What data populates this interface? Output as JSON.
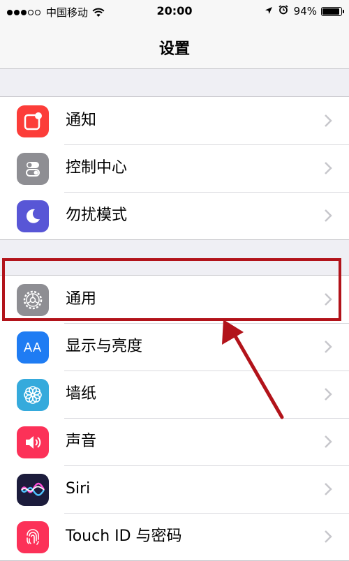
{
  "status_bar": {
    "carrier": "中国移动",
    "time": "20:00",
    "battery_text": "94%",
    "battery_level": 0.94
  },
  "nav": {
    "title": "设置"
  },
  "groups": [
    {
      "items": [
        {
          "label": "通知",
          "icon": "notifications-icon",
          "color": "#fc3d39"
        },
        {
          "label": "控制中心",
          "icon": "control-center-icon",
          "color": "#8e8e93"
        },
        {
          "label": "勿扰模式",
          "icon": "moon-icon",
          "color": "#5856d6"
        }
      ]
    },
    {
      "items": [
        {
          "label": "通用",
          "icon": "gear-icon",
          "color": "#8e8e93"
        },
        {
          "label": "显示与亮度",
          "icon": "display-icon",
          "color": "#1f7cf3",
          "icon_text": "AA"
        },
        {
          "label": "墙纸",
          "icon": "wallpaper-icon",
          "color": "#35aadc"
        },
        {
          "label": "声音",
          "icon": "speaker-icon",
          "color": "#fc3158"
        },
        {
          "label": "Siri",
          "icon": "siri-icon",
          "color": "#1c1c3c"
        },
        {
          "label": "Touch ID 与密码",
          "icon": "fingerprint-icon",
          "color": "#fc3158"
        }
      ]
    }
  ],
  "annotation": {
    "highlight_color": "#b2131a",
    "highlighted_item": "通用"
  }
}
